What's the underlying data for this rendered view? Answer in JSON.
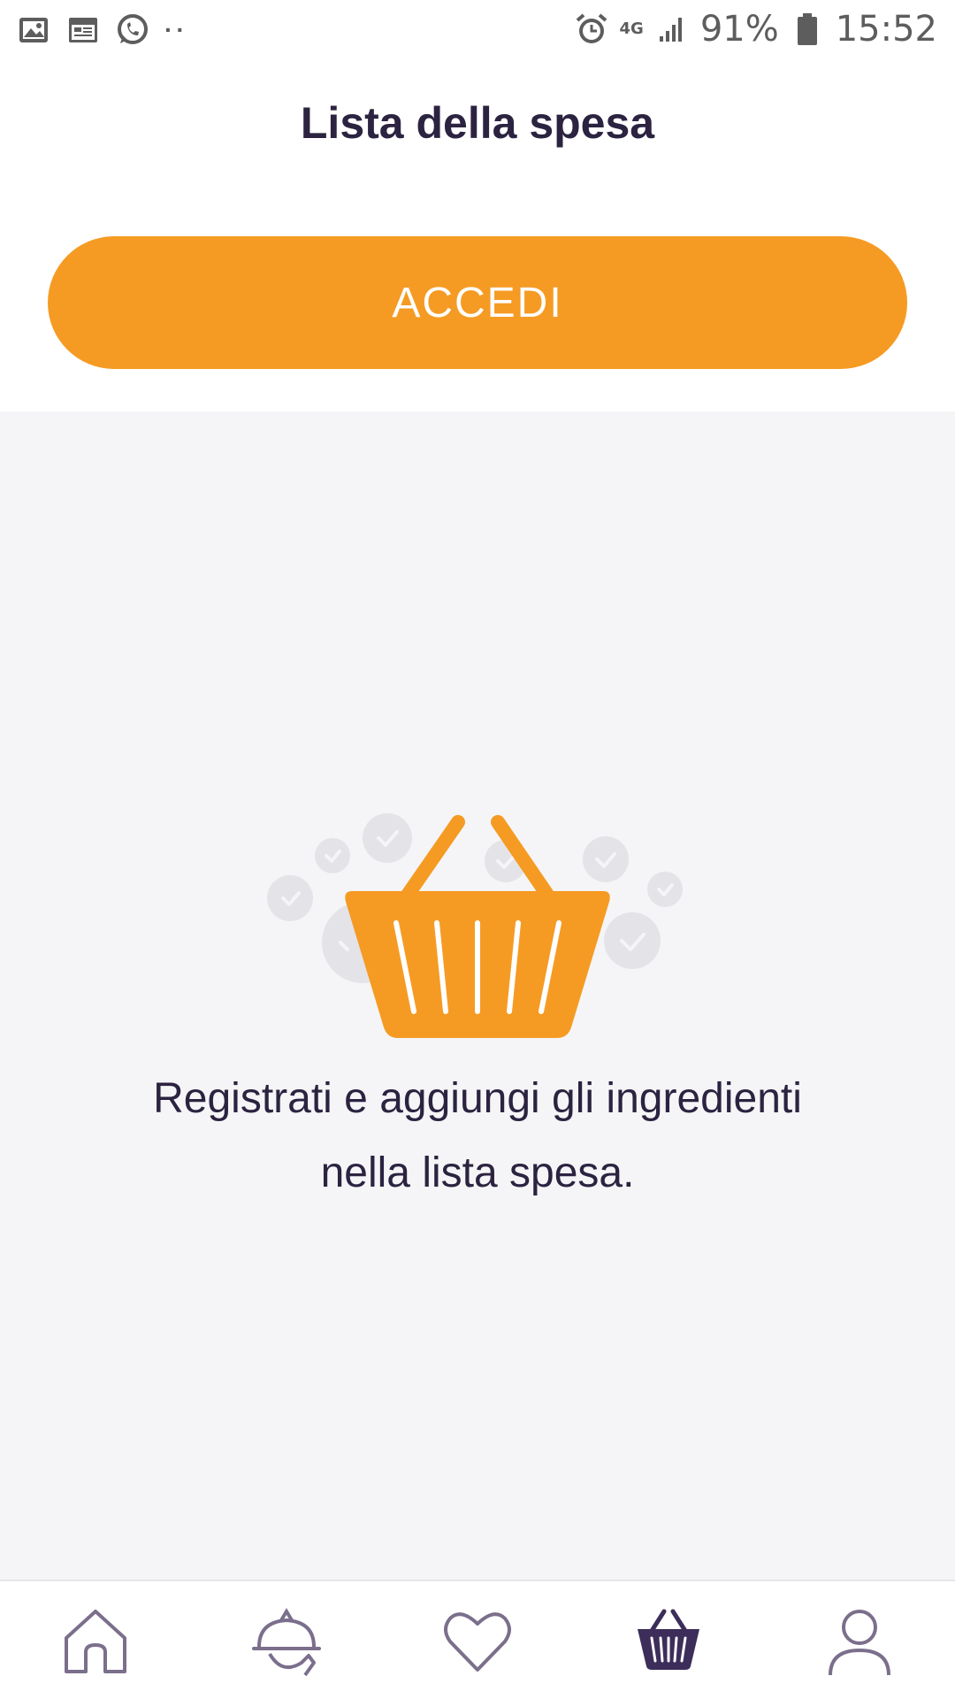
{
  "status_bar": {
    "left_icons": [
      "gallery-icon",
      "calendar-icon",
      "whatsapp-icon",
      "more-dots-icon"
    ],
    "network": "4G",
    "battery": "91%",
    "time": "15:52"
  },
  "header": {
    "title": "Lista della spesa",
    "login_label": "ACCEDI"
  },
  "empty_state": {
    "message": "Registrati e aggiungi gli ingredienti nella lista spesa.",
    "illustration": "shopping-basket-icon"
  },
  "bottom_nav": {
    "items": [
      {
        "icon": "home-icon",
        "active": false
      },
      {
        "icon": "cloche-icon",
        "active": false
      },
      {
        "icon": "heart-icon",
        "active": false
      },
      {
        "icon": "shopping-basket-icon",
        "active": true
      },
      {
        "icon": "profile-icon",
        "active": false
      }
    ]
  },
  "colors": {
    "accent": "#f59b23",
    "text_dark": "#2b2340",
    "nav_inactive": "#7b6f8c",
    "nav_active": "#3c2d5a",
    "background_main": "#f5f5f7"
  }
}
